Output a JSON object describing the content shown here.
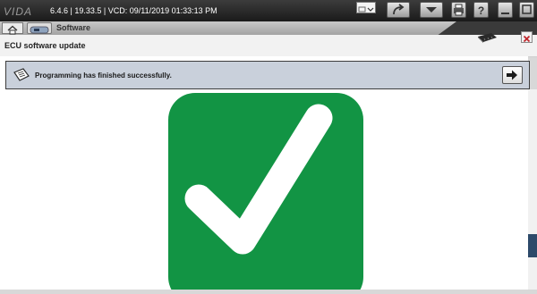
{
  "app": {
    "logo_text": "VIDA",
    "version_line": "6.4.6 | 19.33.5 | VCD: 09/11/2019 01:33:13 PM"
  },
  "toolbar": {
    "buttons": [
      "share-arrow-icon",
      "dropdown-icon",
      "print-icon",
      "help-icon",
      "minimize-icon",
      "maximize-icon"
    ]
  },
  "nav": {
    "current_section": "Software"
  },
  "page": {
    "title": "ECU software update"
  },
  "message": {
    "text": "Programming has finished successfully."
  },
  "status": {
    "result_icon": "check-mark-icon",
    "result_color": "#129444"
  },
  "colors": {
    "title_bar": "#222222",
    "message_bar": "#c9d0db",
    "close_x": "#c0262c"
  }
}
